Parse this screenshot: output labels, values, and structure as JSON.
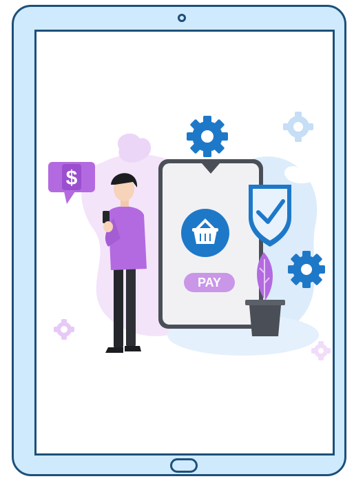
{
  "illustration": {
    "pay_label": "PAY",
    "currency_symbol": "$",
    "icons": [
      "gear-icon",
      "shopping-basket-icon",
      "shield-check-icon",
      "dollar-speech-bubble-icon",
      "plant-pot-icon",
      "cloud-icon"
    ]
  },
  "colors": {
    "tablet_frame": "#cfeafc",
    "tablet_outline": "#1d4f7a",
    "accent_blue": "#1e78c8",
    "accent_purple": "#b36ae0",
    "light_lavender": "#efdcf7",
    "light_blue": "#dcecfb"
  }
}
